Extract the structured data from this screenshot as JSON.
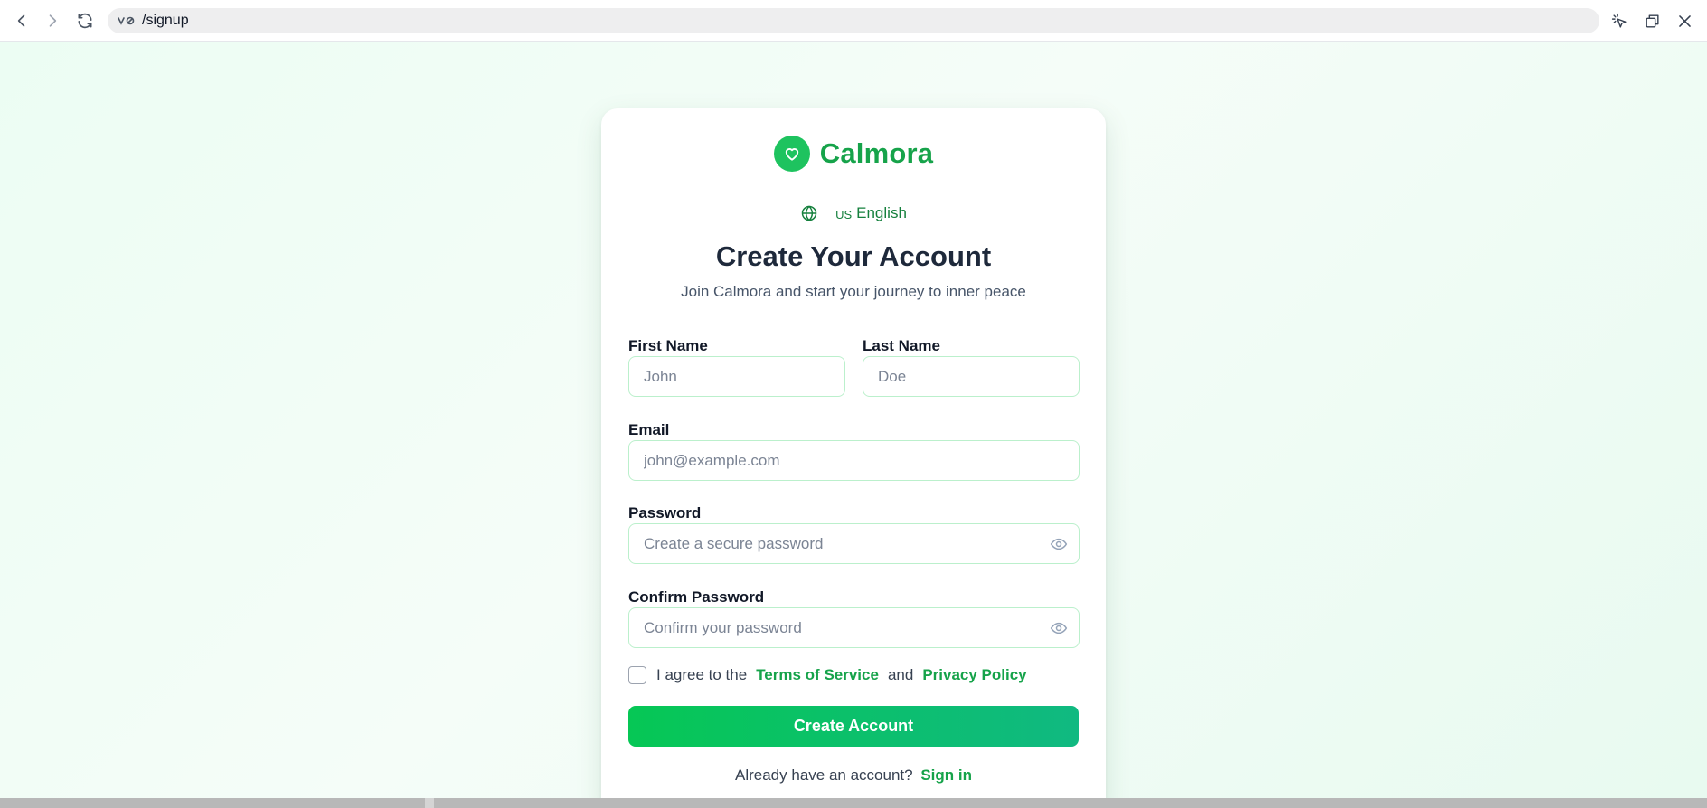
{
  "browser": {
    "url": "/signup",
    "icons": [
      "back-icon",
      "forward-icon",
      "reload-icon",
      "site-info-icon",
      "cursor-select-icon",
      "window-restore-icon",
      "close-icon"
    ]
  },
  "brand": {
    "name": "Calmora",
    "icon": "heart-icon",
    "color": "#16a34a"
  },
  "language": {
    "code": "US",
    "label": "English",
    "icon": "globe-icon"
  },
  "form": {
    "title": "Create Your Account",
    "subtitle": "Join Calmora and start your journey to inner peace",
    "first_name": {
      "label": "First Name",
      "placeholder": "John",
      "value": ""
    },
    "last_name": {
      "label": "Last Name",
      "placeholder": "Doe",
      "value": ""
    },
    "email": {
      "label": "Email",
      "placeholder": "john@example.com",
      "value": ""
    },
    "password": {
      "label": "Password",
      "placeholder": "Create a secure password",
      "value": "",
      "toggle_icon": "eye-icon"
    },
    "confirm_password": {
      "label": "Confirm Password",
      "placeholder": "Confirm your password",
      "value": "",
      "toggle_icon": "eye-icon"
    },
    "agree": {
      "checked": false,
      "prefix": "I agree to the",
      "terms_link": "Terms of Service",
      "conjunction": "and",
      "privacy_link": "Privacy Policy"
    },
    "submit_label": "Create Account",
    "signin_prompt": "Already have an account?",
    "signin_link": "Sign in"
  },
  "colors": {
    "accent": "#16a34a",
    "button_start": "#06c755",
    "button_end": "#10b981",
    "background": "#ecfdf3",
    "input_border": "#bbf0cc"
  }
}
